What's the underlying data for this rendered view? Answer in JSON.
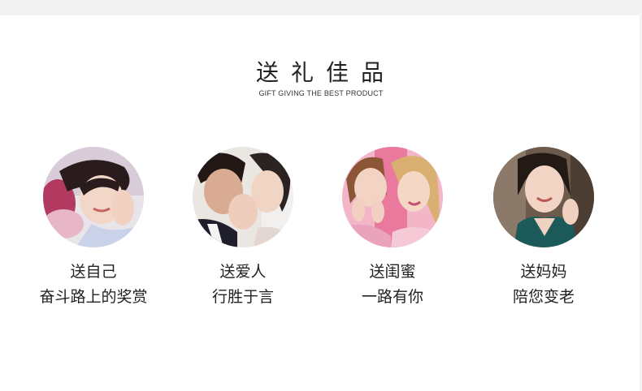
{
  "section": {
    "title": "送礼佳品",
    "subtitle": "GIFT GIVING THE BEST PRODUCT"
  },
  "cards": [
    {
      "line1": "送自己",
      "line2": "奋斗路上的奖赏"
    },
    {
      "line1": "送爱人",
      "line2": "行胜于言"
    },
    {
      "line1": "送闺蜜",
      "line2": "一路有你"
    },
    {
      "line1": "送妈妈",
      "line2": "陪您变老"
    }
  ],
  "colors": {
    "strip": "#f3f3f3",
    "text": "#222222"
  }
}
